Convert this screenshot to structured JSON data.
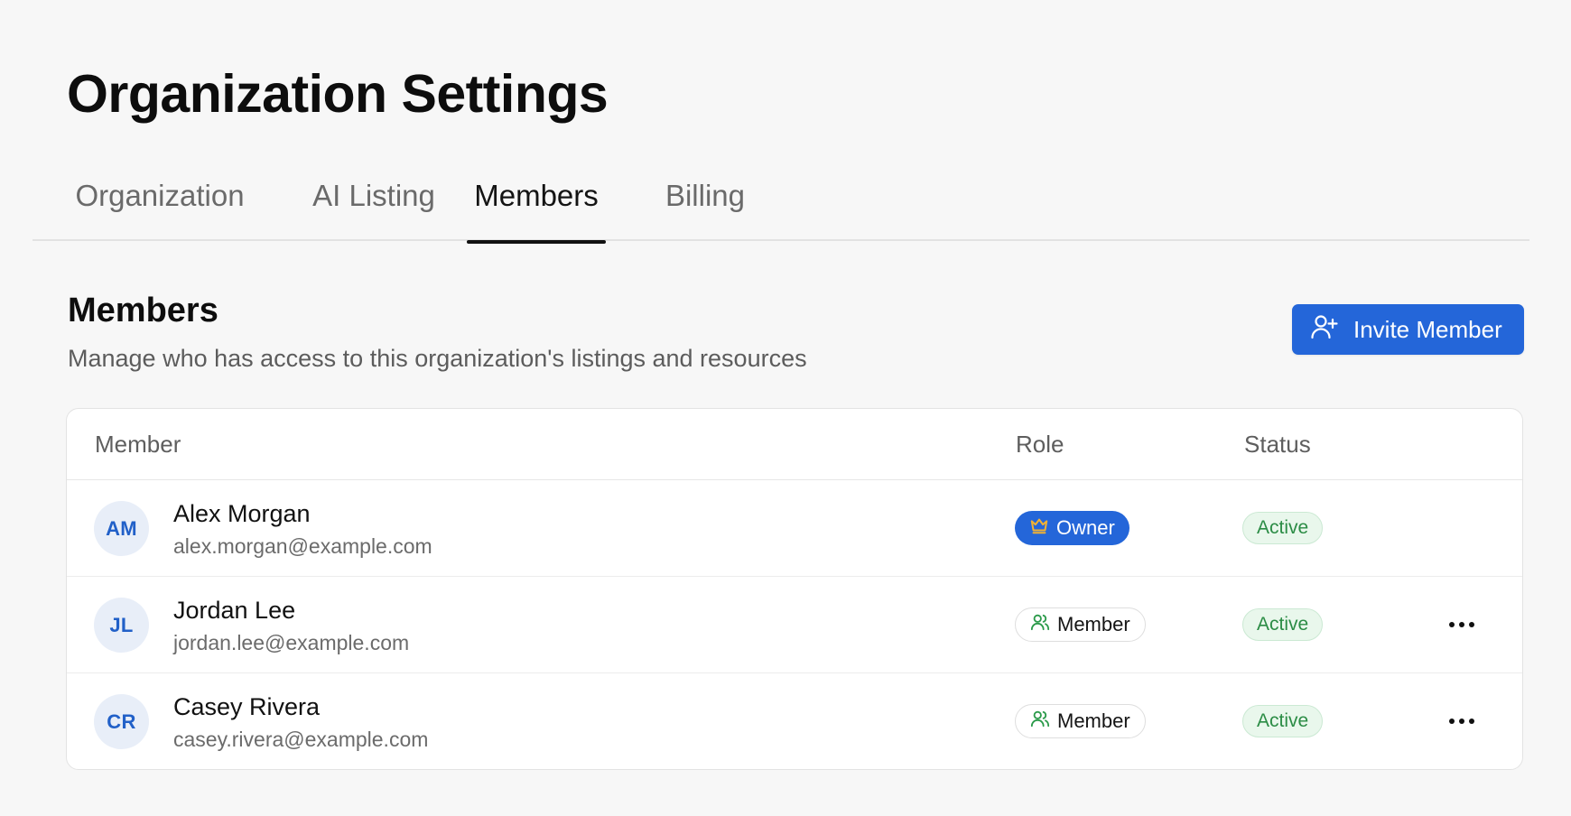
{
  "page": {
    "title": "Organization Settings"
  },
  "tabs": [
    {
      "label": "Organization",
      "active": false
    },
    {
      "label": "AI Listing",
      "active": false
    },
    {
      "label": "Members",
      "active": true
    },
    {
      "label": "Billing",
      "active": false
    }
  ],
  "section": {
    "title": "Members",
    "description": "Manage who has access to this organization's listings and resources"
  },
  "invite_button": {
    "label": "Invite Member",
    "icon": "user-plus-icon",
    "color": "#2466d9"
  },
  "table": {
    "headers": {
      "member": "Member",
      "role": "Role",
      "status": "Status"
    },
    "rows": [
      {
        "initials": "AM",
        "name": "Alex Morgan",
        "email": "alex.morgan@example.com",
        "role": "Owner",
        "role_icon": "crown-icon",
        "status": "Active",
        "has_actions": false
      },
      {
        "initials": "JL",
        "name": "Jordan Lee",
        "email": "jordan.lee@example.com",
        "role": "Member",
        "role_icon": "users-icon",
        "status": "Active",
        "has_actions": true
      },
      {
        "initials": "CR",
        "name": "Casey Rivera",
        "email": "casey.rivera@example.com",
        "role": "Member",
        "role_icon": "users-icon",
        "status": "Active",
        "has_actions": true
      }
    ]
  },
  "colors": {
    "accent": "#2466d9",
    "status_active_bg": "#e9f7ec",
    "status_active_text": "#2b8c45",
    "avatar_bg": "#e8eef8",
    "owner_crown": "#f2b233",
    "member_icon": "#2b9a4a"
  }
}
